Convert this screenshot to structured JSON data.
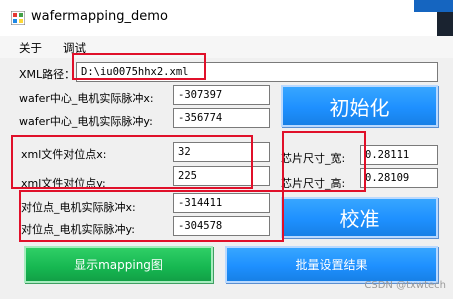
{
  "window": {
    "title": "wafermapping_demo"
  },
  "menu": [
    {
      "label": "关于"
    },
    {
      "label": "调试"
    }
  ],
  "xml": {
    "label": "XML路径：",
    "value": "D:\\iu0075hhx2.xml"
  },
  "wafer_center": {
    "x_label": "wafer中心_电机实际脉冲x:",
    "x_value": "-307397",
    "y_label": "wafer中心_电机实际脉冲y:",
    "y_value": "-356774"
  },
  "xml_align": {
    "x_label": "xml文件对位点x:",
    "x_value": "32",
    "y_label": "xml文件对位点y:",
    "y_value": "225"
  },
  "align_motor": {
    "x_label": "对位点_电机实际脉冲x:",
    "x_value": "-314411",
    "y_label": "对位点_电机实际脉冲y:",
    "y_value": "-304578"
  },
  "chip_size": {
    "width_label": "芯片尺寸_宽:",
    "width_value": "0.28111",
    "height_label": "芯片尺寸_高:",
    "height_value": "0.28109"
  },
  "buttons": {
    "init": "初始化",
    "calibrate": "校准",
    "show_mapping": "显示mapping图",
    "batch_settings": "批量设置结果"
  },
  "watermark": "CSDN @txwtech",
  "colors": {
    "button_blue": "#1e90ff",
    "button_green": "#16b751",
    "highlight_red": "#e0102a"
  }
}
